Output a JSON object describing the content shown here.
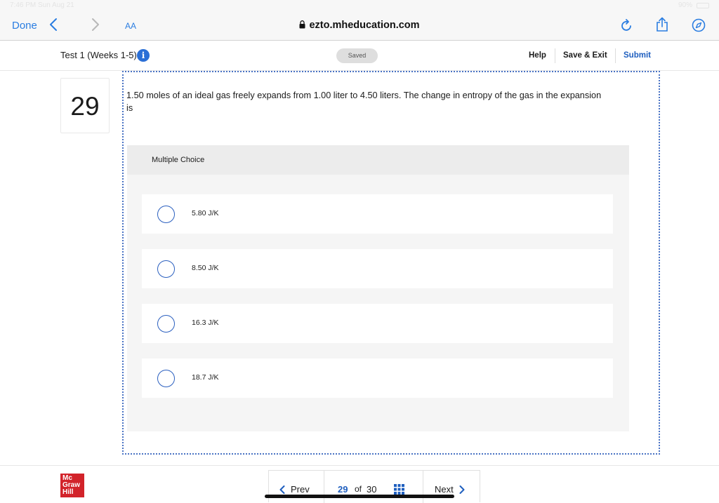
{
  "status_bar": {
    "time": "7:46 PM   Sun Aug 21",
    "battery": "90%"
  },
  "browser": {
    "done_label": "Done",
    "aa_label": "AA",
    "url": "ezto.mheducation.com"
  },
  "header": {
    "test_title": "Test 1 (Weeks 1-5)",
    "info_symbol": "i",
    "saved_label": "Saved",
    "help_label": "Help",
    "save_exit_label": "Save & Exit",
    "submit_label": "Submit"
  },
  "question": {
    "number": "29",
    "text": "1.50 moles of an ideal gas freely expands from 1.00 liter to 4.50 liters. The change in entropy of the gas in the expansion is",
    "type_label": "Multiple Choice",
    "choices": [
      {
        "label": "5.80 J/K"
      },
      {
        "label": "8.50 J/K"
      },
      {
        "label": "16.3 J/K"
      },
      {
        "label": "18.7 J/K"
      }
    ]
  },
  "footer": {
    "logo_lines": [
      "Mc",
      "Graw",
      "Hill"
    ],
    "prev_label": "Prev",
    "current_page": "29",
    "of_label": "of",
    "total_pages": "30",
    "next_label": "Next"
  },
  "colors": {
    "accent": "#2b6fd6",
    "link": "#1f5fbf",
    "brand": "#d2232a"
  }
}
